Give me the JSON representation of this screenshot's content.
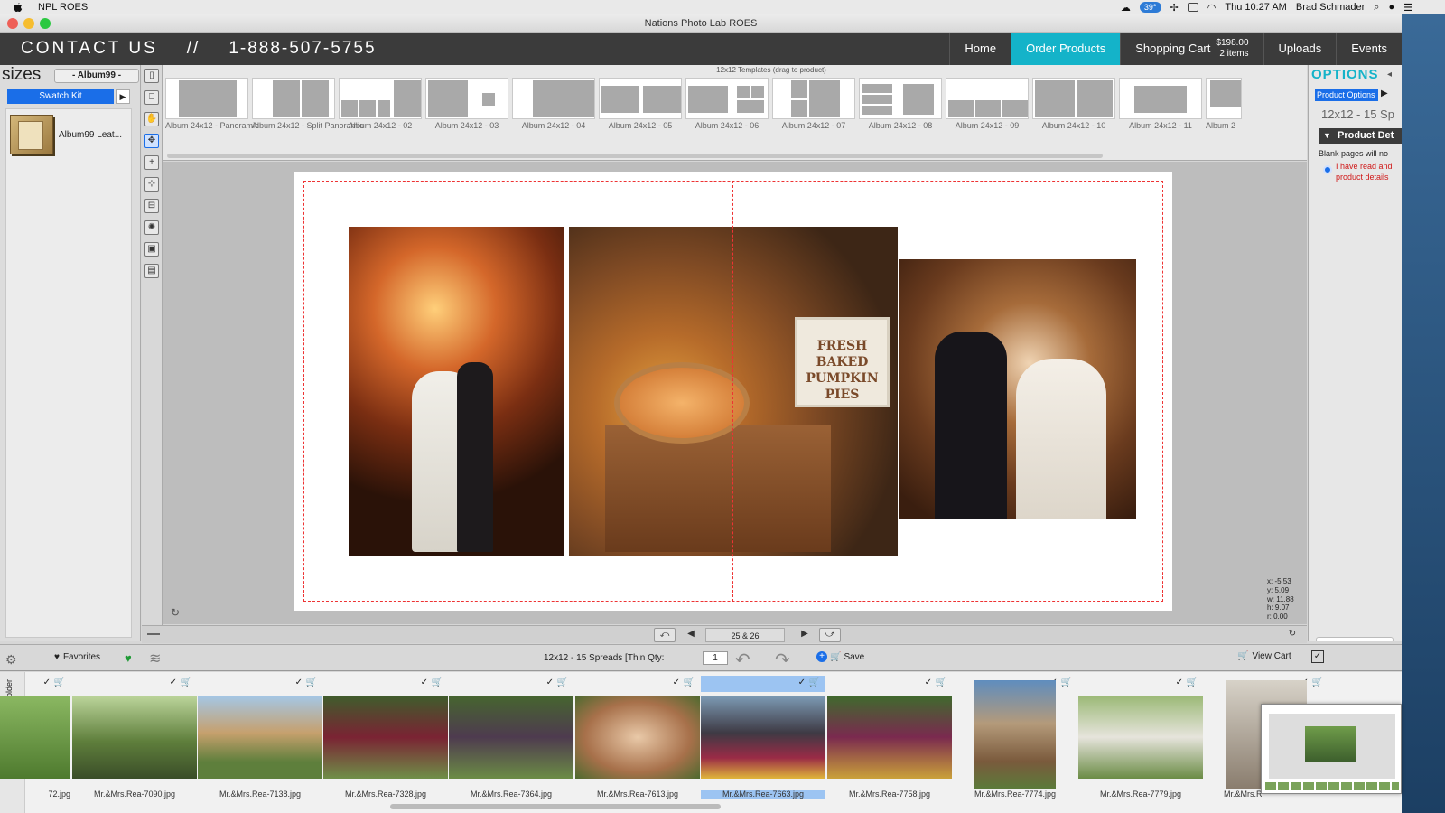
{
  "menubar": {
    "app_name": "NPL ROES",
    "weather": "39°",
    "time": "Thu 10:27 AM",
    "user": "Brad Schmader"
  },
  "window": {
    "title": "Nations Photo Lab ROES"
  },
  "header": {
    "contact": "CONTACT US",
    "separator": "//",
    "phone": "1-888-507-5755",
    "nav": {
      "home": "Home",
      "order_products": "Order Products",
      "shopping_cart": "Shopping Cart",
      "cart_amount": "$198.00",
      "cart_items": "2 items",
      "uploads": "Uploads",
      "events": "Events"
    }
  },
  "left_panel": {
    "sizes_label": "sizes",
    "album_select": "- Album99 -",
    "swatch_kit": "Swatch Kit",
    "products": [
      {
        "label": "Album99 Leat..."
      }
    ]
  },
  "templates": {
    "title": "12x12 Templates (drag to product)",
    "items": [
      {
        "label": "Album 24x12 - Panoramic"
      },
      {
        "label": "Album 24x12 - Split Panoramic"
      },
      {
        "label": "Album 24x12 - 02"
      },
      {
        "label": "Album 24x12 - 03"
      },
      {
        "label": "Album 24x12 - 04"
      },
      {
        "label": "Album 24x12 - 05"
      },
      {
        "label": "Album 24x12 - 06"
      },
      {
        "label": "Album 24x12 - 07"
      },
      {
        "label": "Album 24x12 - 08"
      },
      {
        "label": "Album 24x12 - 09"
      },
      {
        "label": "Album 24x12 - 10"
      },
      {
        "label": "Album 24x12 - 11"
      },
      {
        "label": "Album 2"
      }
    ]
  },
  "canvas": {
    "sign_text": "FRESH BAKED PUMPKIN PIES",
    "coords": {
      "x": "x: -5.53",
      "y": "y: 5.09",
      "w": "w: 11.88",
      "h": "h: 9.07",
      "r": "r: 0.00"
    }
  },
  "options": {
    "title": "OPTIONS",
    "product_options": "Product Options",
    "product_sub": "12x12 - 15 Sp",
    "product_details": "Product Det",
    "blank_note": "Blank pages will no",
    "warning_line1": "I have read and",
    "warning_line2": "product details"
  },
  "navbar": {
    "page": "25 & 26"
  },
  "toolbar": {
    "favorites": "Favorites",
    "order_label": "12x12 - 15 Spreads [Thin Qty:",
    "qty": "1",
    "save": "Save",
    "view_cart": "View Cart"
  },
  "filmstrip": {
    "add_folder": "Add Folder",
    "items": [
      {
        "name": "72.jpg"
      },
      {
        "name": "Mr.&Mrs.Rea-7090.jpg"
      },
      {
        "name": "Mr.&Mrs.Rea-7138.jpg"
      },
      {
        "name": "Mr.&Mrs.Rea-7328.jpg"
      },
      {
        "name": "Mr.&Mrs.Rea-7364.jpg"
      },
      {
        "name": "Mr.&Mrs.Rea-7613.jpg"
      },
      {
        "name": "Mr.&Mrs.Rea-7663.jpg"
      },
      {
        "name": "Mr.&Mrs.Rea-7758.jpg"
      },
      {
        "name": "Mr.&Mrs.Rea-7774.jpg"
      },
      {
        "name": "Mr.&Mrs.Rea-7779.jpg"
      },
      {
        "name": "Mr.&Mrs.R"
      }
    ]
  }
}
